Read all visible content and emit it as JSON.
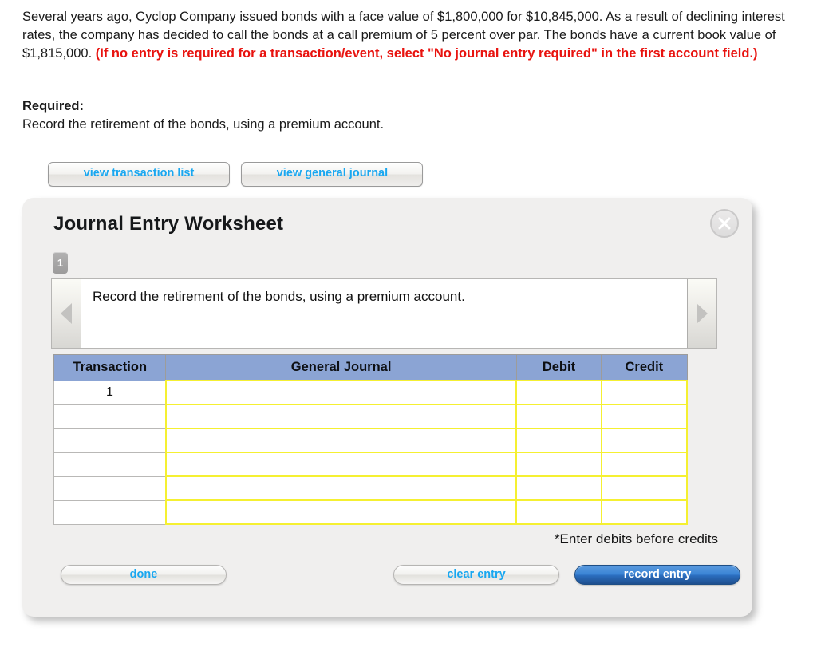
{
  "problem": {
    "body_part1": "Several years ago, Cyclop Company issued bonds with a face value of $1,800,000 for $10,845,000. As a result of declining interest rates, the company has decided to call the bonds at a call premium of 5 percent over par. The bonds have a current book value of $1,815,000. ",
    "red_note": "(If no entry is required for a transaction/event, select \"No journal entry required\" in the first account field.)",
    "required_label": "Required:",
    "required_text": "Record the retirement of the bonds, using a premium account."
  },
  "toolbar": {
    "view_transaction_list": "view transaction list",
    "view_general_journal": "view general journal"
  },
  "panel": {
    "title": "Journal Entry Worksheet",
    "close_icon": "close-x-icon",
    "step_number": "1",
    "instruction": "Record the retirement of the bonds, using a premium account.",
    "prev_icon": "triangle-left-icon",
    "next_icon": "triangle-right-icon",
    "debits_note": "*Enter debits before credits"
  },
  "table": {
    "headers": [
      "Transaction",
      "General Journal",
      "Debit",
      "Credit"
    ],
    "rows": [
      {
        "transaction": "1",
        "general_journal": "",
        "debit": "",
        "credit": ""
      },
      {
        "transaction": "",
        "general_journal": "",
        "debit": "",
        "credit": ""
      },
      {
        "transaction": "",
        "general_journal": "",
        "debit": "",
        "credit": ""
      },
      {
        "transaction": "",
        "general_journal": "",
        "debit": "",
        "credit": ""
      },
      {
        "transaction": "",
        "general_journal": "",
        "debit": "",
        "credit": ""
      },
      {
        "transaction": "",
        "general_journal": "",
        "debit": "",
        "credit": ""
      }
    ]
  },
  "footer": {
    "done": "done",
    "clear_entry": "clear entry",
    "record_entry": "record entry"
  },
  "colors": {
    "link_blue": "#19a7f0",
    "header_blue": "#8ba4d4",
    "input_yellow": "#f5f031",
    "alert_red": "#e8130f",
    "record_entry_blue": "#2a6cbd"
  }
}
